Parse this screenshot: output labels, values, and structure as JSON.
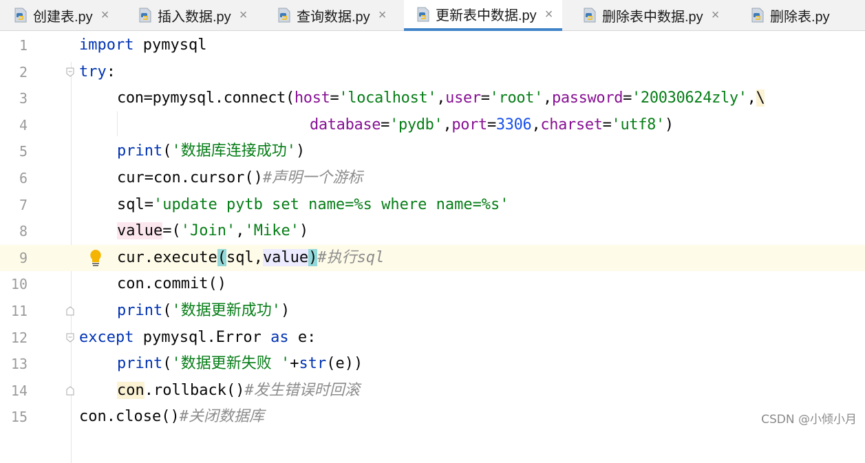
{
  "tabs": [
    {
      "label": "创建表.py",
      "active": false
    },
    {
      "label": "插入数据.py",
      "active": false
    },
    {
      "label": "查询数据.py",
      "active": false
    },
    {
      "label": "更新表中数据.py",
      "active": true
    },
    {
      "label": "删除表中数据.py",
      "active": false
    },
    {
      "label": "删除表.py",
      "active": false
    }
  ],
  "tab_close_glyph": "×",
  "line_numbers": [
    "1",
    "2",
    "3",
    "4",
    "5",
    "6",
    "7",
    "8",
    "9",
    "10",
    "11",
    "12",
    "13",
    "14",
    "15"
  ],
  "code": {
    "l1": {
      "kw": "import",
      "rest": " pymysql"
    },
    "l2": {
      "kw": "try",
      "rest": ":"
    },
    "l3": {
      "a": "con=pymysql.connect(",
      "p1": "host",
      "eq1": "=",
      "s1": "'localhost'",
      "c1": ",",
      "p2": "user",
      "eq2": "=",
      "s2": "'root'",
      "c2": ",",
      "p3": "password",
      "eq3": "=",
      "s3": "'20030624zly'",
      "c3": ",",
      "slash": "\\"
    },
    "l4": {
      "p1": "database",
      "eq1": "=",
      "s1": "'pydb'",
      "c1": ",",
      "p2": "port",
      "eq2": "=",
      "n2": "3306",
      "c2": ",",
      "p3": "charset",
      "eq3": "=",
      "s3": "'utf8'",
      "end": ")"
    },
    "l5": {
      "kw": "print",
      "open": "(",
      "s": "'数据库连接成功'",
      "close": ")"
    },
    "l6": {
      "a": "cur=con.cursor()",
      "cmt": "#声明一个游标"
    },
    "l7": {
      "a": "sql=",
      "s": "'update pytb set name=%s where name=%s'"
    },
    "l8": {
      "v": "value",
      "a": "=(",
      "s1": "'Join'",
      "c": ",",
      "s2": "'Mike'",
      "end": ")"
    },
    "l9": {
      "a": "cur.execute",
      "po": "(",
      "b": "sql,",
      "v": "value",
      "pc": ")",
      "cmt": "#执行sql"
    },
    "l10": {
      "a": "con.commit()"
    },
    "l11": {
      "kw": "print",
      "open": "(",
      "s": "'数据更新成功'",
      "close": ")"
    },
    "l12": {
      "kw": "except",
      "mid": " pymysql.Error ",
      "kw2": "as",
      "rest": " e:"
    },
    "l13": {
      "kw": "print",
      "open": "(",
      "s": "'数据更新失败 '",
      "plus": "+",
      "kw2": "str",
      "rest": "(e))"
    },
    "l14": {
      "v": "con",
      "a": ".rollback()",
      "cmt": "#发生错误时回滚"
    },
    "l15": {
      "a": "con.close()",
      "cmt": "#关闭数据库"
    }
  },
  "watermark": "CSDN @小倾小月",
  "colors": {
    "keyword": "#0033b3",
    "string": "#067d17",
    "number": "#1750eb",
    "param": "#871094",
    "comment": "#8c8c8c",
    "active_tab_underline": "#4083c9"
  }
}
